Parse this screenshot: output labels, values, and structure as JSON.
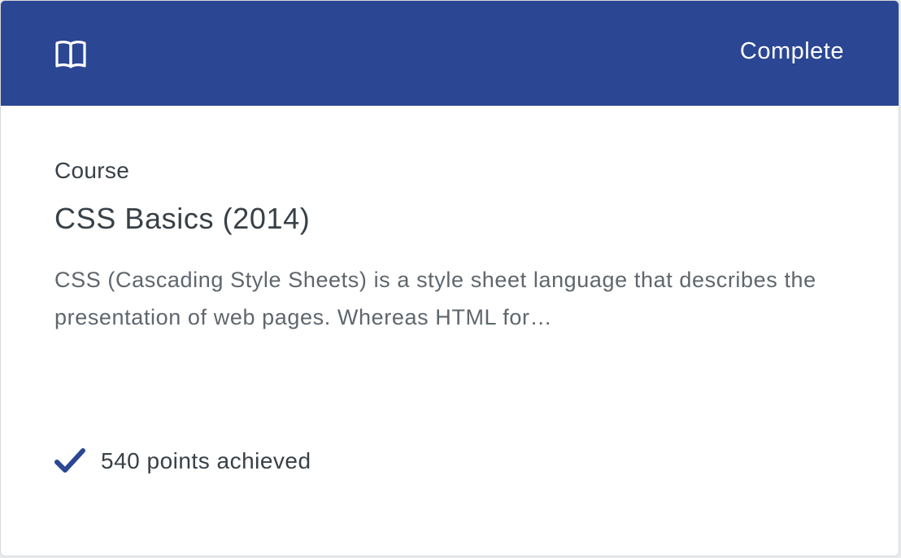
{
  "header": {
    "icon": "book-open-icon",
    "status": "Complete",
    "accent_color": "#2b4693"
  },
  "body": {
    "type": "Course",
    "title": "CSS Basics (2014)",
    "description": "CSS (Cascading Style Sheets) is a style sheet language that describes the presentation of web pages. Whereas HTML for…"
  },
  "footer": {
    "icon": "checkmark-icon",
    "points_text": "540 points achieved"
  }
}
